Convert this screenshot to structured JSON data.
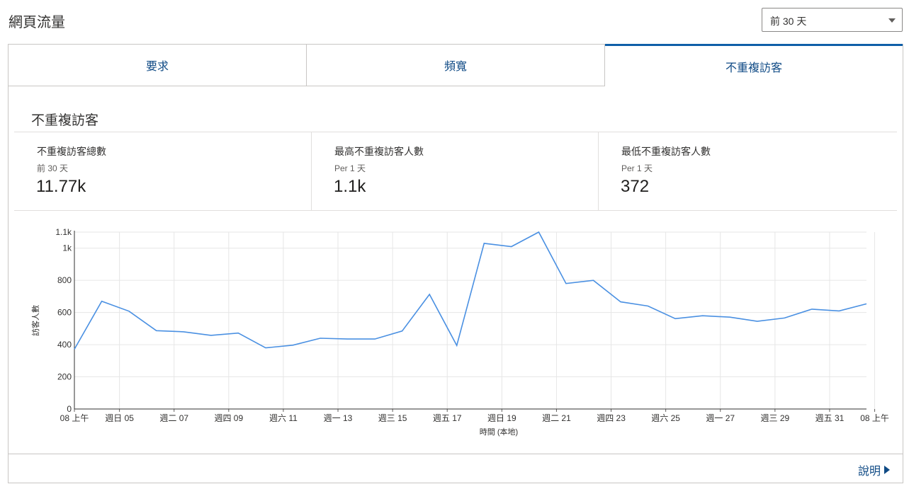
{
  "header": {
    "title": "網頁流量"
  },
  "range_select": {
    "value": "前 30 天"
  },
  "tabs": [
    {
      "label": "要求"
    },
    {
      "label": "頻寬"
    },
    {
      "label": "不重複訪客",
      "selected": true
    }
  ],
  "section": {
    "title": "不重複訪客"
  },
  "stats": [
    {
      "label": "不重複訪客總數",
      "sub": "前 30 天",
      "value": "11.77k"
    },
    {
      "label": "最高不重複訪客人數",
      "sub": "Per 1 天",
      "value": "1.1k"
    },
    {
      "label": "最低不重複訪客人數",
      "sub": "Per 1 天",
      "value": "372"
    }
  ],
  "footer": {
    "help_label": "說明"
  },
  "colors": {
    "accent": "#0f5fa8",
    "link": "#0f4a85",
    "line": "#4a90e2"
  },
  "chart_data": {
    "type": "line",
    "ylabel": "訪客人數",
    "xlabel": "時間 (本地)",
    "ylim": [
      0,
      1100
    ],
    "yticks": [
      0,
      200,
      400,
      600,
      800,
      1000,
      1100
    ],
    "ytick_labels": [
      "0",
      "200",
      "400",
      "600",
      "800",
      "1k",
      "1.1k"
    ],
    "xtick_labels": [
      "08 上午",
      "週日 05",
      "週二 07",
      "週四 09",
      "週六 11",
      "週一 13",
      "週三 15",
      "週五 17",
      "週日 19",
      "週二 21",
      "週四 23",
      "週六 25",
      "週一 27",
      "週三 29",
      "週五 31",
      "08 上午"
    ],
    "xtick_index": [
      0,
      1.65,
      3.65,
      5.65,
      7.65,
      9.65,
      11.65,
      13.65,
      15.65,
      17.65,
      19.65,
      21.65,
      23.65,
      25.65,
      27.65,
      29.3
    ],
    "x_count": 31,
    "series": [
      {
        "values": [
          372,
          670,
          608,
          487,
          480,
          458,
          472,
          380,
          397,
          440,
          435,
          435,
          485,
          713,
          395,
          1030,
          1010,
          1100,
          780,
          800,
          666,
          640,
          562,
          580,
          571,
          545,
          566,
          621,
          610,
          654
        ]
      }
    ],
    "grid": true
  }
}
